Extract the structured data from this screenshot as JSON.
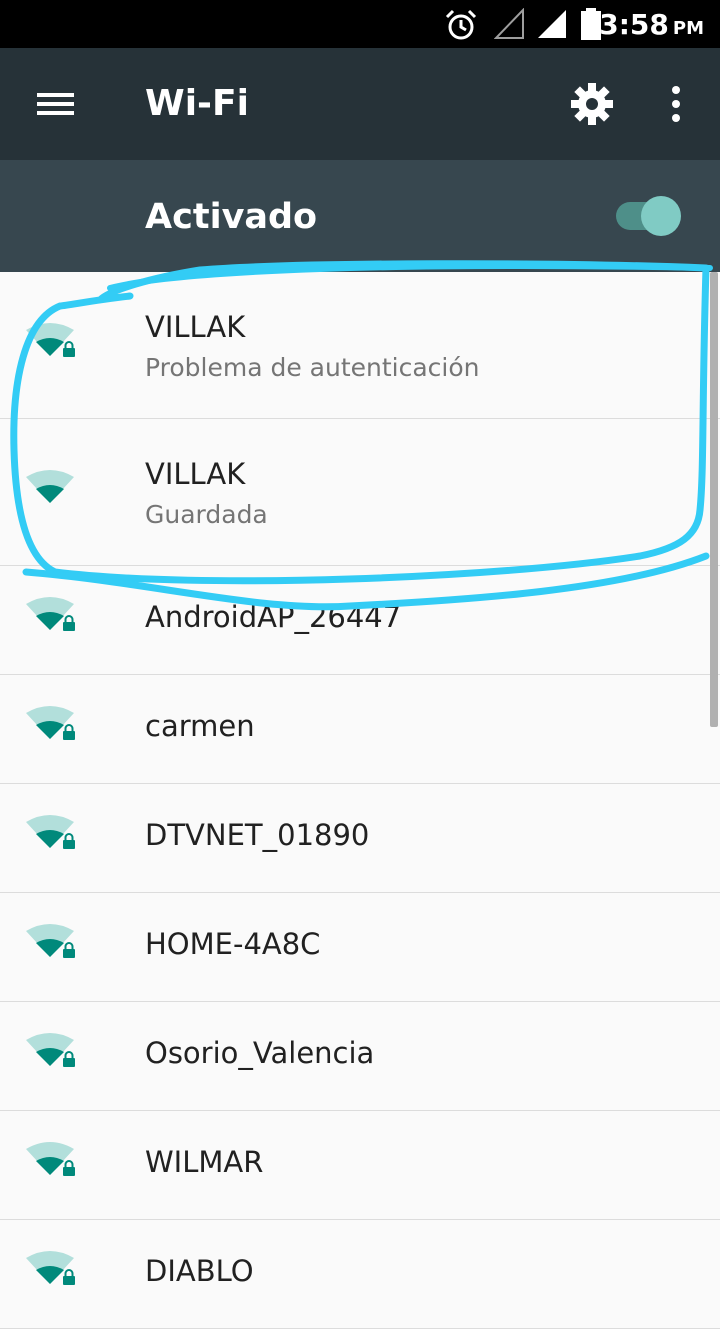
{
  "status_bar": {
    "time": "3:58",
    "ampm": "PM",
    "icons": [
      "alarm-icon",
      "signal-empty-icon",
      "signal-icon",
      "battery-icon"
    ]
  },
  "toolbar": {
    "title": "Wi-Fi",
    "icons": [
      "menu-icon",
      "gear-icon",
      "more-vert-icon"
    ]
  },
  "wifi_switch": {
    "label": "Activado",
    "on": true
  },
  "colors": {
    "toolbar_bg": "#263238",
    "switchbar_bg": "#37474f",
    "accent": "#009688",
    "annotation": "#33ccf5"
  },
  "networks": [
    {
      "ssid": "VILLAK",
      "status": "Problema de autenticación",
      "locked": true
    },
    {
      "ssid": "VILLAK",
      "status": "Guardada",
      "locked": false
    },
    {
      "ssid": "AndroidAP_26447",
      "locked": true
    },
    {
      "ssid": "carmen",
      "locked": true
    },
    {
      "ssid": "DTVNET_01890",
      "locked": true
    },
    {
      "ssid": "HOME-4A8C",
      "locked": true
    },
    {
      "ssid": "Osorio_Valencia",
      "locked": true
    },
    {
      "ssid": "WILMAR",
      "locked": true
    },
    {
      "ssid": "DIABLO",
      "locked": true
    }
  ]
}
